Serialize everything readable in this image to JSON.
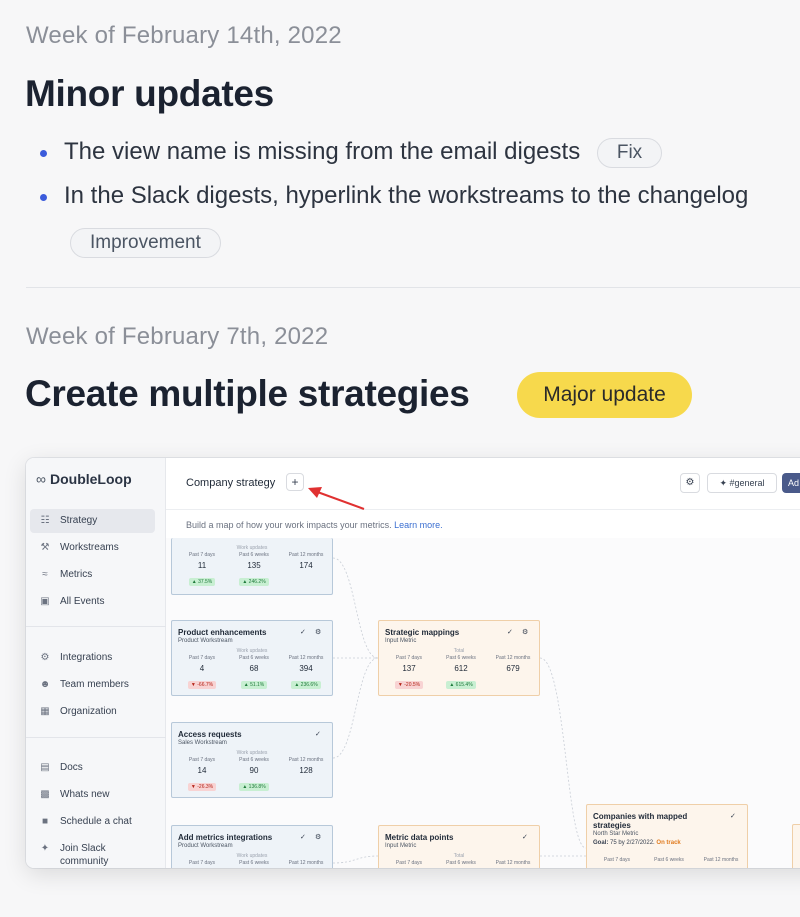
{
  "sections": [
    {
      "week": "Week of February 14th, 2022",
      "title": "Minor updates",
      "items": [
        {
          "text": "The view name is missing from the email digests",
          "tag": "Fix"
        },
        {
          "text": "In the Slack digests, hyperlink the workstreams to the changelog",
          "tag": "Improvement"
        }
      ]
    },
    {
      "week": "Week of February 7th, 2022",
      "title": "Create multiple strategies",
      "badge": "Major update"
    }
  ],
  "app": {
    "logo": "DoubleLoop",
    "nav": [
      {
        "label": "Strategy",
        "icon": "tree-icon",
        "active": true
      },
      {
        "label": "Workstreams",
        "icon": "hammer-icon"
      },
      {
        "label": "Metrics",
        "icon": "chart-icon"
      },
      {
        "label": "All Events",
        "icon": "inbox-icon"
      },
      {
        "label": "Integrations",
        "icon": "plug-icon"
      },
      {
        "label": "Team members",
        "icon": "people-icon"
      },
      {
        "label": "Organization",
        "icon": "building-icon"
      },
      {
        "label": "Docs",
        "icon": "book-icon"
      },
      {
        "label": "Whats new",
        "icon": "news-icon"
      },
      {
        "label": "Schedule a chat",
        "icon": "calendar-icon"
      },
      {
        "label": "Join Slack community",
        "icon": "slack-icon"
      }
    ],
    "topbar": {
      "title": "Company strategy",
      "plus": "+",
      "channel": "#general",
      "action": "Ad"
    },
    "hint": "Build a map of how your work impacts your metrics.",
    "hint_link": "Learn more.",
    "cards": {
      "top": {
        "updates": "Work updates",
        "cols": [
          {
            "p": "Past 7 days",
            "v": "11",
            "d": "▲ 37.5%",
            "dir": "up"
          },
          {
            "p": "Past 6 weeks",
            "v": "135",
            "d": "▲ 246.2%",
            "dir": "up"
          },
          {
            "p": "Past 12 months",
            "v": "174",
            "d": "",
            "dir": ""
          }
        ]
      },
      "product": {
        "title": "Product enhancements",
        "sub": "Product Workstream",
        "updates": "Work updates",
        "cols": [
          {
            "p": "Past 7 days",
            "v": "4",
            "d": "▼ -66.7%",
            "dir": "dn"
          },
          {
            "p": "Past 6 weeks",
            "v": "68",
            "d": "▲ 51.1%",
            "dir": "up"
          },
          {
            "p": "Past 12 months",
            "v": "394",
            "d": "▲ 236.6%",
            "dir": "up"
          }
        ]
      },
      "access": {
        "title": "Access requests",
        "sub": "Sales Workstream",
        "updates": "Work updates",
        "cols": [
          {
            "p": "Past 7 days",
            "v": "14",
            "d": "▼ -26.3%",
            "dir": "dn"
          },
          {
            "p": "Past 6 weeks",
            "v": "90",
            "d": "▲ 136.8%",
            "dir": "up"
          },
          {
            "p": "Past 12 months",
            "v": "128",
            "d": "",
            "dir": ""
          }
        ]
      },
      "addmetrics": {
        "title": "Add metrics integrations",
        "sub": "Product Workstream",
        "updates": "Work updates",
        "cols": [
          {
            "p": "Past 7 days"
          },
          {
            "p": "Past 6 weeks"
          },
          {
            "p": "Past 12 months"
          }
        ]
      },
      "mappings": {
        "title": "Strategic mappings",
        "sub": "Input Metric",
        "updates": "Total",
        "cols": [
          {
            "p": "Past 7 days",
            "v": "137",
            "d": "▼ -20.5%",
            "dir": "dn"
          },
          {
            "p": "Past 6 weeks",
            "v": "612",
            "d": "▲ 615.4%",
            "dir": "up"
          },
          {
            "p": "Past 12 months",
            "v": "679",
            "d": "",
            "dir": ""
          }
        ]
      },
      "datapoints": {
        "title": "Metric data points",
        "sub": "Input Metric",
        "updates": "Total",
        "cols": [
          {
            "p": "Past 7 days"
          },
          {
            "p": "Past 6 weeks"
          },
          {
            "p": "Past 12 months"
          }
        ]
      },
      "companies": {
        "title": "Companies with mapped strategies",
        "sub": "North Star Metric",
        "goal_label": "Goal:",
        "goal": "75 by 2/27/2022.",
        "status": "On track",
        "cols": [
          {
            "p": "Past 7 days"
          },
          {
            "p": "Past 6 weeks"
          },
          {
            "p": "Past 12 months"
          }
        ]
      }
    }
  }
}
